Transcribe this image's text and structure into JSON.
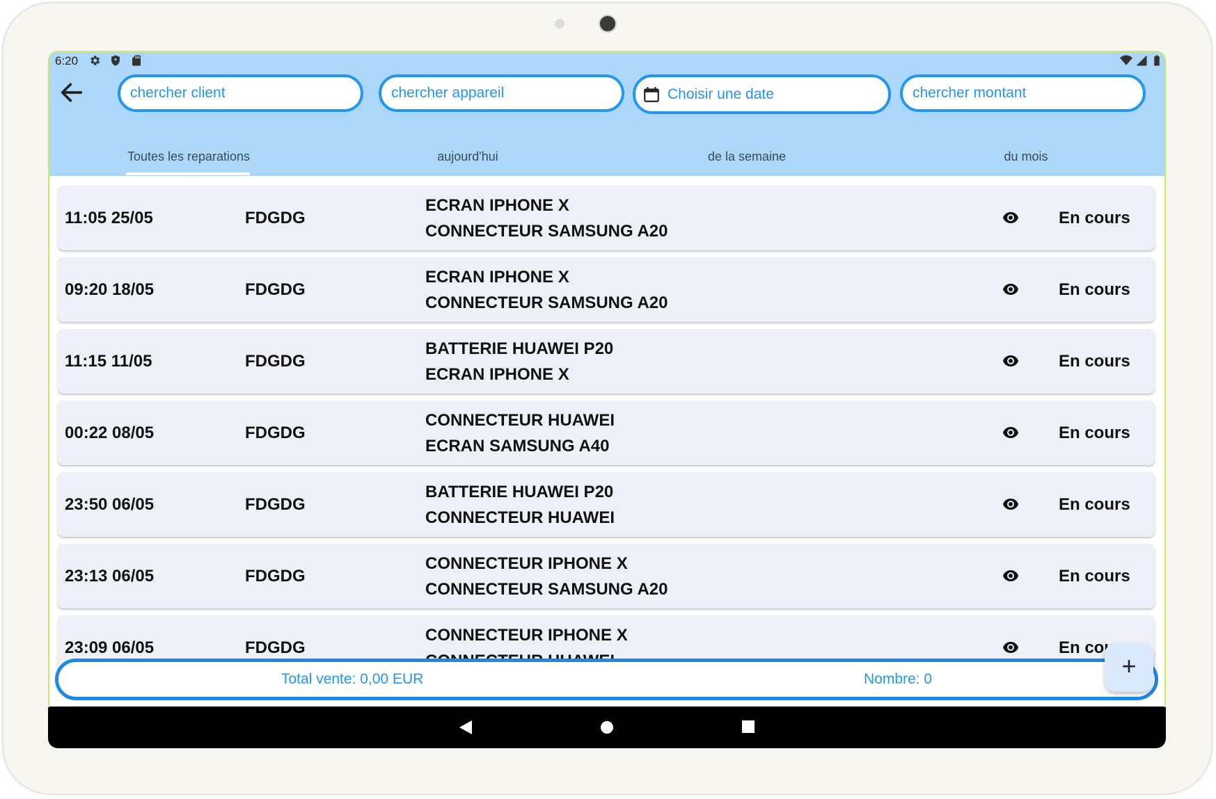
{
  "status_bar": {
    "time": "6:20",
    "left_icons": [
      "gear-icon",
      "shield-icon",
      "sd-card-icon"
    ],
    "right_icons": [
      "wifi-icon",
      "signal-icon",
      "battery-icon"
    ]
  },
  "search": {
    "client_placeholder": "chercher client",
    "device_placeholder": "chercher appareil",
    "date_label": "Choisir une date",
    "amount_placeholder": "chercher montant"
  },
  "tabs": [
    {
      "label": "Toutes les reparations",
      "selected": true
    },
    {
      "label": "aujourd'hui",
      "selected": false
    },
    {
      "label": "de la semaine",
      "selected": false
    },
    {
      "label": "du mois",
      "selected": false
    }
  ],
  "repairs": [
    {
      "datetime": "11:05 25/05",
      "client": "FDGDG",
      "device1": "ECRAN IPHONE X",
      "device2": "CONNECTEUR SAMSUNG A20",
      "status": "En cours"
    },
    {
      "datetime": "09:20 18/05",
      "client": "FDGDG",
      "device1": "ECRAN IPHONE X",
      "device2": "CONNECTEUR SAMSUNG A20",
      "status": "En cours"
    },
    {
      "datetime": "11:15 11/05",
      "client": "FDGDG",
      "device1": "BATTERIE HUAWEI P20",
      "device2": "ECRAN IPHONE X",
      "status": "En cours"
    },
    {
      "datetime": "00:22 08/05",
      "client": "FDGDG",
      "device1": "CONNECTEUR HUAWEI",
      "device2": "ECRAN SAMSUNG A40",
      "status": "En cours"
    },
    {
      "datetime": "23:50 06/05",
      "client": "FDGDG",
      "device1": "BATTERIE HUAWEI P20",
      "device2": "CONNECTEUR HUAWEI",
      "status": "En cours"
    },
    {
      "datetime": "23:13 06/05",
      "client": "FDGDG",
      "device1": "CONNECTEUR IPHONE X",
      "device2": "CONNECTEUR SAMSUNG A20",
      "status": "En cours"
    },
    {
      "datetime": "23:09 06/05",
      "client": "FDGDG",
      "device1": "CONNECTEUR IPHONE X",
      "device2": "CONNECTEUR HUAWEI",
      "status": "En cours"
    }
  ],
  "summary": {
    "total_label": "Total vente: 0,00 EUR",
    "count_label": "Nombre: 0"
  },
  "fab": {
    "label": "+"
  },
  "colors": {
    "app_bar": "#add7f8",
    "accent": "#2196f3",
    "card": "#eef0f8"
  }
}
